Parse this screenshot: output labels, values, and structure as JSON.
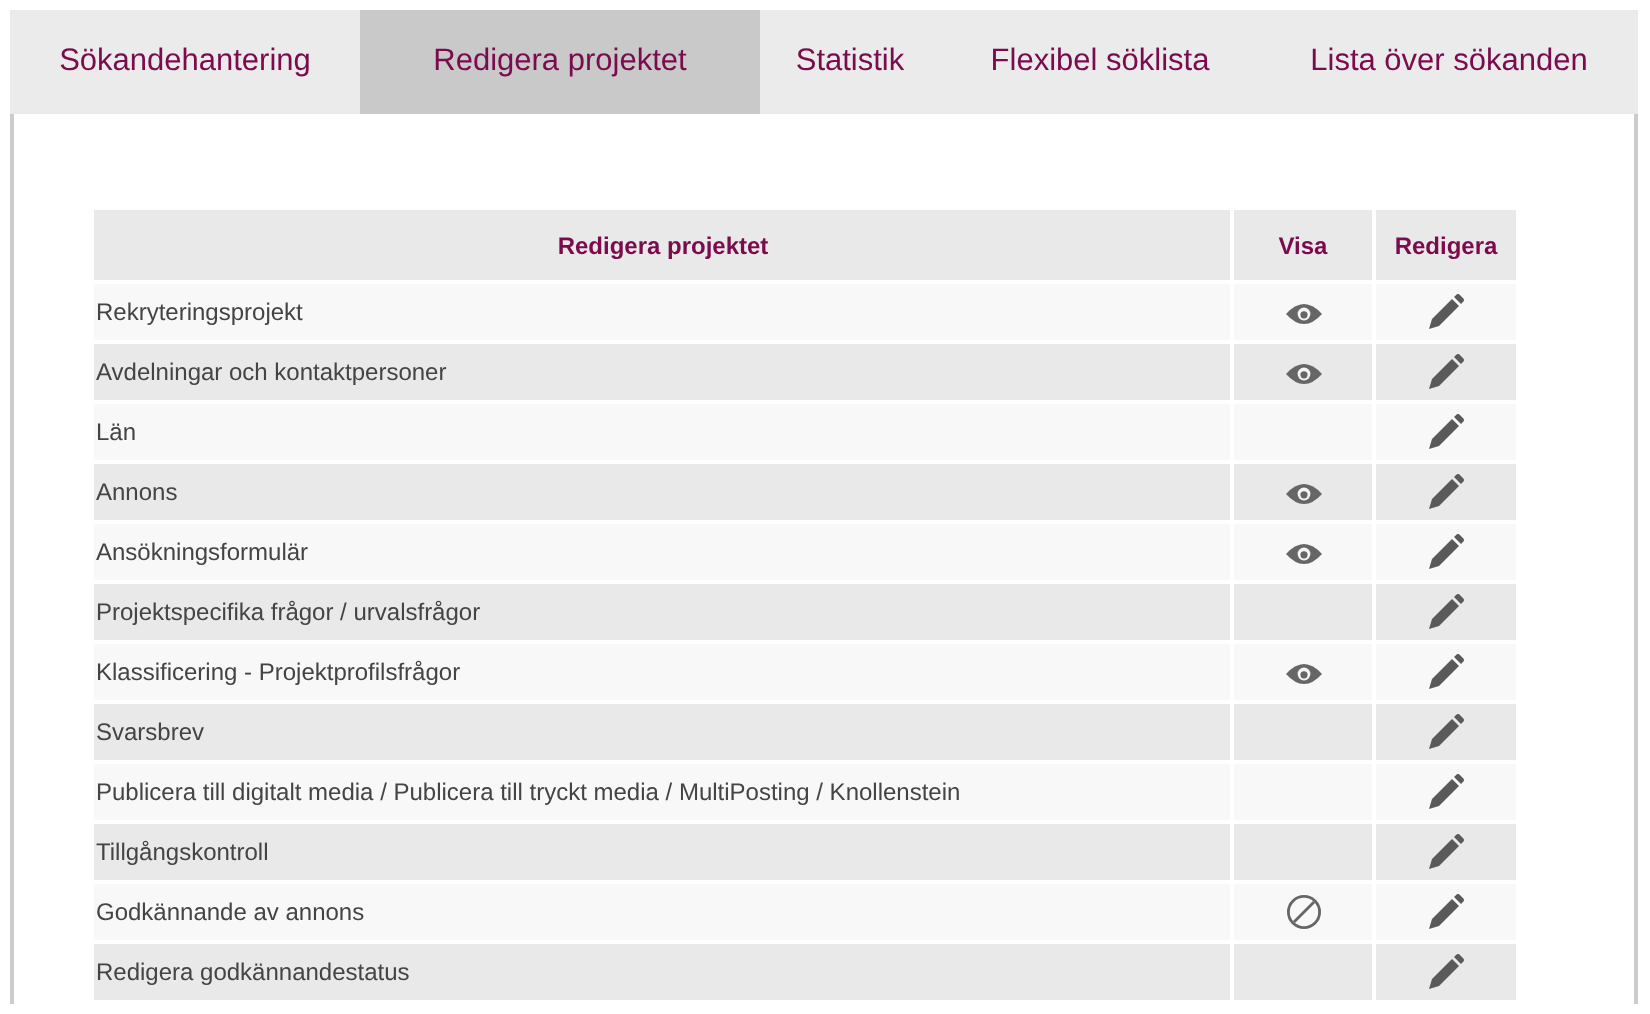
{
  "tabs": [
    {
      "label": "Sökandehantering",
      "selected": false
    },
    {
      "label": "Redigera projektet",
      "selected": true
    },
    {
      "label": "Statistik",
      "selected": false
    },
    {
      "label": "Flexibel söklista",
      "selected": false
    },
    {
      "label": "Lista över sökanden",
      "selected": false
    }
  ],
  "table": {
    "columns": [
      "Redigera projektet",
      "Visa",
      "Redigera"
    ],
    "rows": [
      {
        "name": "Rekryteringsprojekt",
        "viewable": true,
        "blocked": false
      },
      {
        "name": "Avdelningar och kontaktpersoner",
        "viewable": true,
        "blocked": false
      },
      {
        "name": "Län",
        "viewable": false,
        "blocked": false
      },
      {
        "name": "Annons",
        "viewable": true,
        "blocked": false
      },
      {
        "name": "Ansökningsformulär",
        "viewable": true,
        "blocked": false
      },
      {
        "name": "Projektspecifika frågor / urvalsfrågor",
        "viewable": false,
        "blocked": false
      },
      {
        "name": "Klassificering - Projektprofilsfrågor",
        "viewable": true,
        "blocked": false
      },
      {
        "name": "Svarsbrev",
        "viewable": false,
        "blocked": false
      },
      {
        "name": "Publicera till digitalt media / Publicera till tryckt media / MultiPosting / Knollenstein",
        "viewable": false,
        "blocked": false
      },
      {
        "name": "Tillgångskontroll",
        "viewable": false,
        "blocked": false
      },
      {
        "name": "Godkännande av annons",
        "viewable": false,
        "blocked": true
      },
      {
        "name": "Redigera godkännandestatus",
        "viewable": false,
        "blocked": false
      }
    ]
  }
}
